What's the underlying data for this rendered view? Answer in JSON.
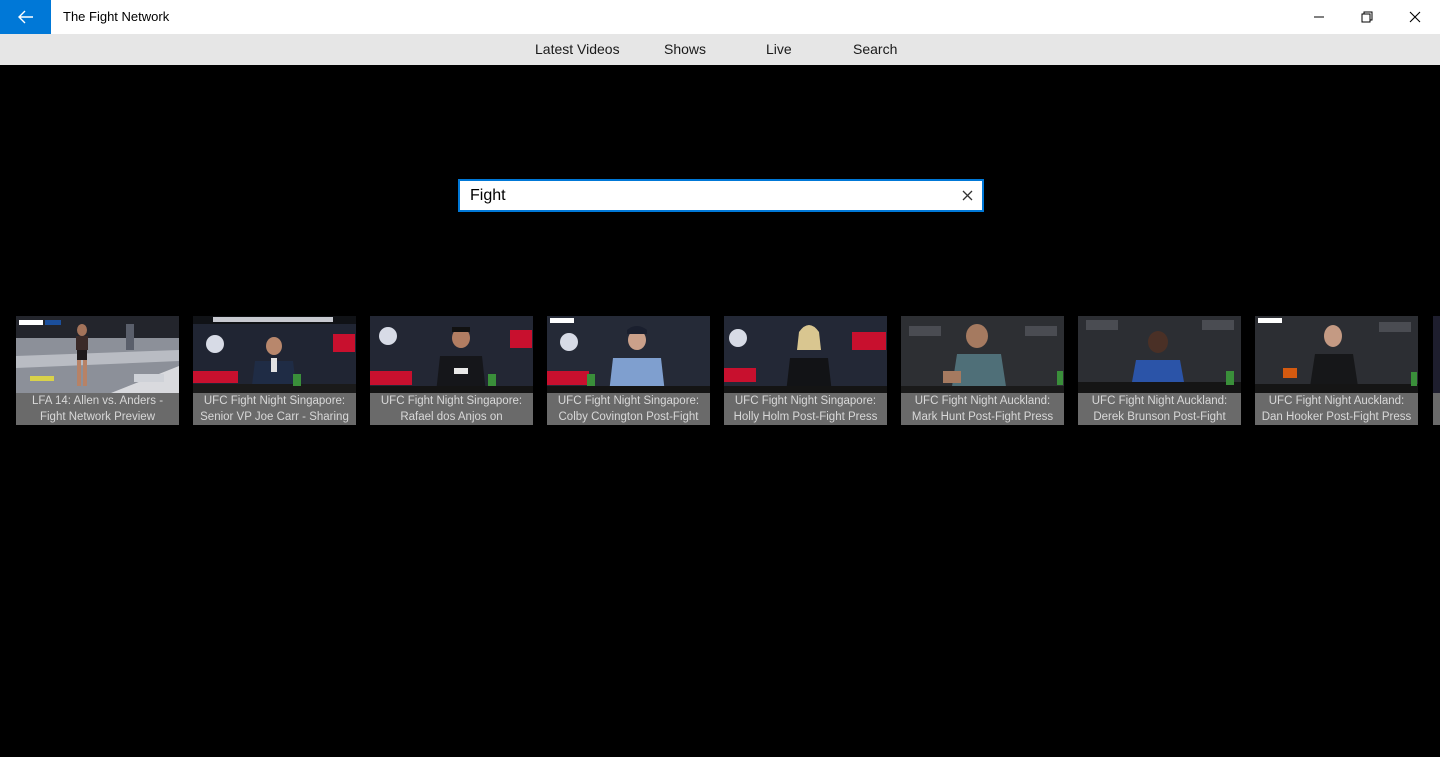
{
  "window": {
    "title": "The Fight Network",
    "back_icon": "arrow-left-icon",
    "controls": [
      "minimize-icon",
      "maximize-icon",
      "close-icon"
    ],
    "accent_color": "#0078d7"
  },
  "nav": {
    "items": [
      {
        "label": "Latest Videos"
      },
      {
        "label": "Shows"
      },
      {
        "label": "Live"
      },
      {
        "label": "Search"
      }
    ]
  },
  "search": {
    "value": "Fight",
    "clear_icon": "clear-icon"
  },
  "results": [
    {
      "caption": "LFA 14: Allen vs. Anders - Fight Network Preview",
      "thumb": "octagon"
    },
    {
      "caption": "UFC Fight Night Singapore: Senior VP Joe Carr - Sharing",
      "thumb": "presser"
    },
    {
      "caption": "UFC Fight Night Singapore: Rafael dos Anjos on",
      "thumb": "presser"
    },
    {
      "caption": "UFC Fight Night Singapore: Colby Covington Post-Fight",
      "thumb": "presser"
    },
    {
      "caption": "UFC Fight Night Singapore: Holly Holm Post-Fight Press",
      "thumb": "presser"
    },
    {
      "caption": "UFC Fight Night Auckland: Mark Hunt Post-Fight Press",
      "thumb": "auckland"
    },
    {
      "caption": "UFC Fight Night Auckland: Derek Brunson Post-Fight",
      "thumb": "auckland"
    },
    {
      "caption": "UFC Fight Night Auckland: Dan Hooker Post-Fight Press",
      "thumb": "auckland"
    }
  ]
}
